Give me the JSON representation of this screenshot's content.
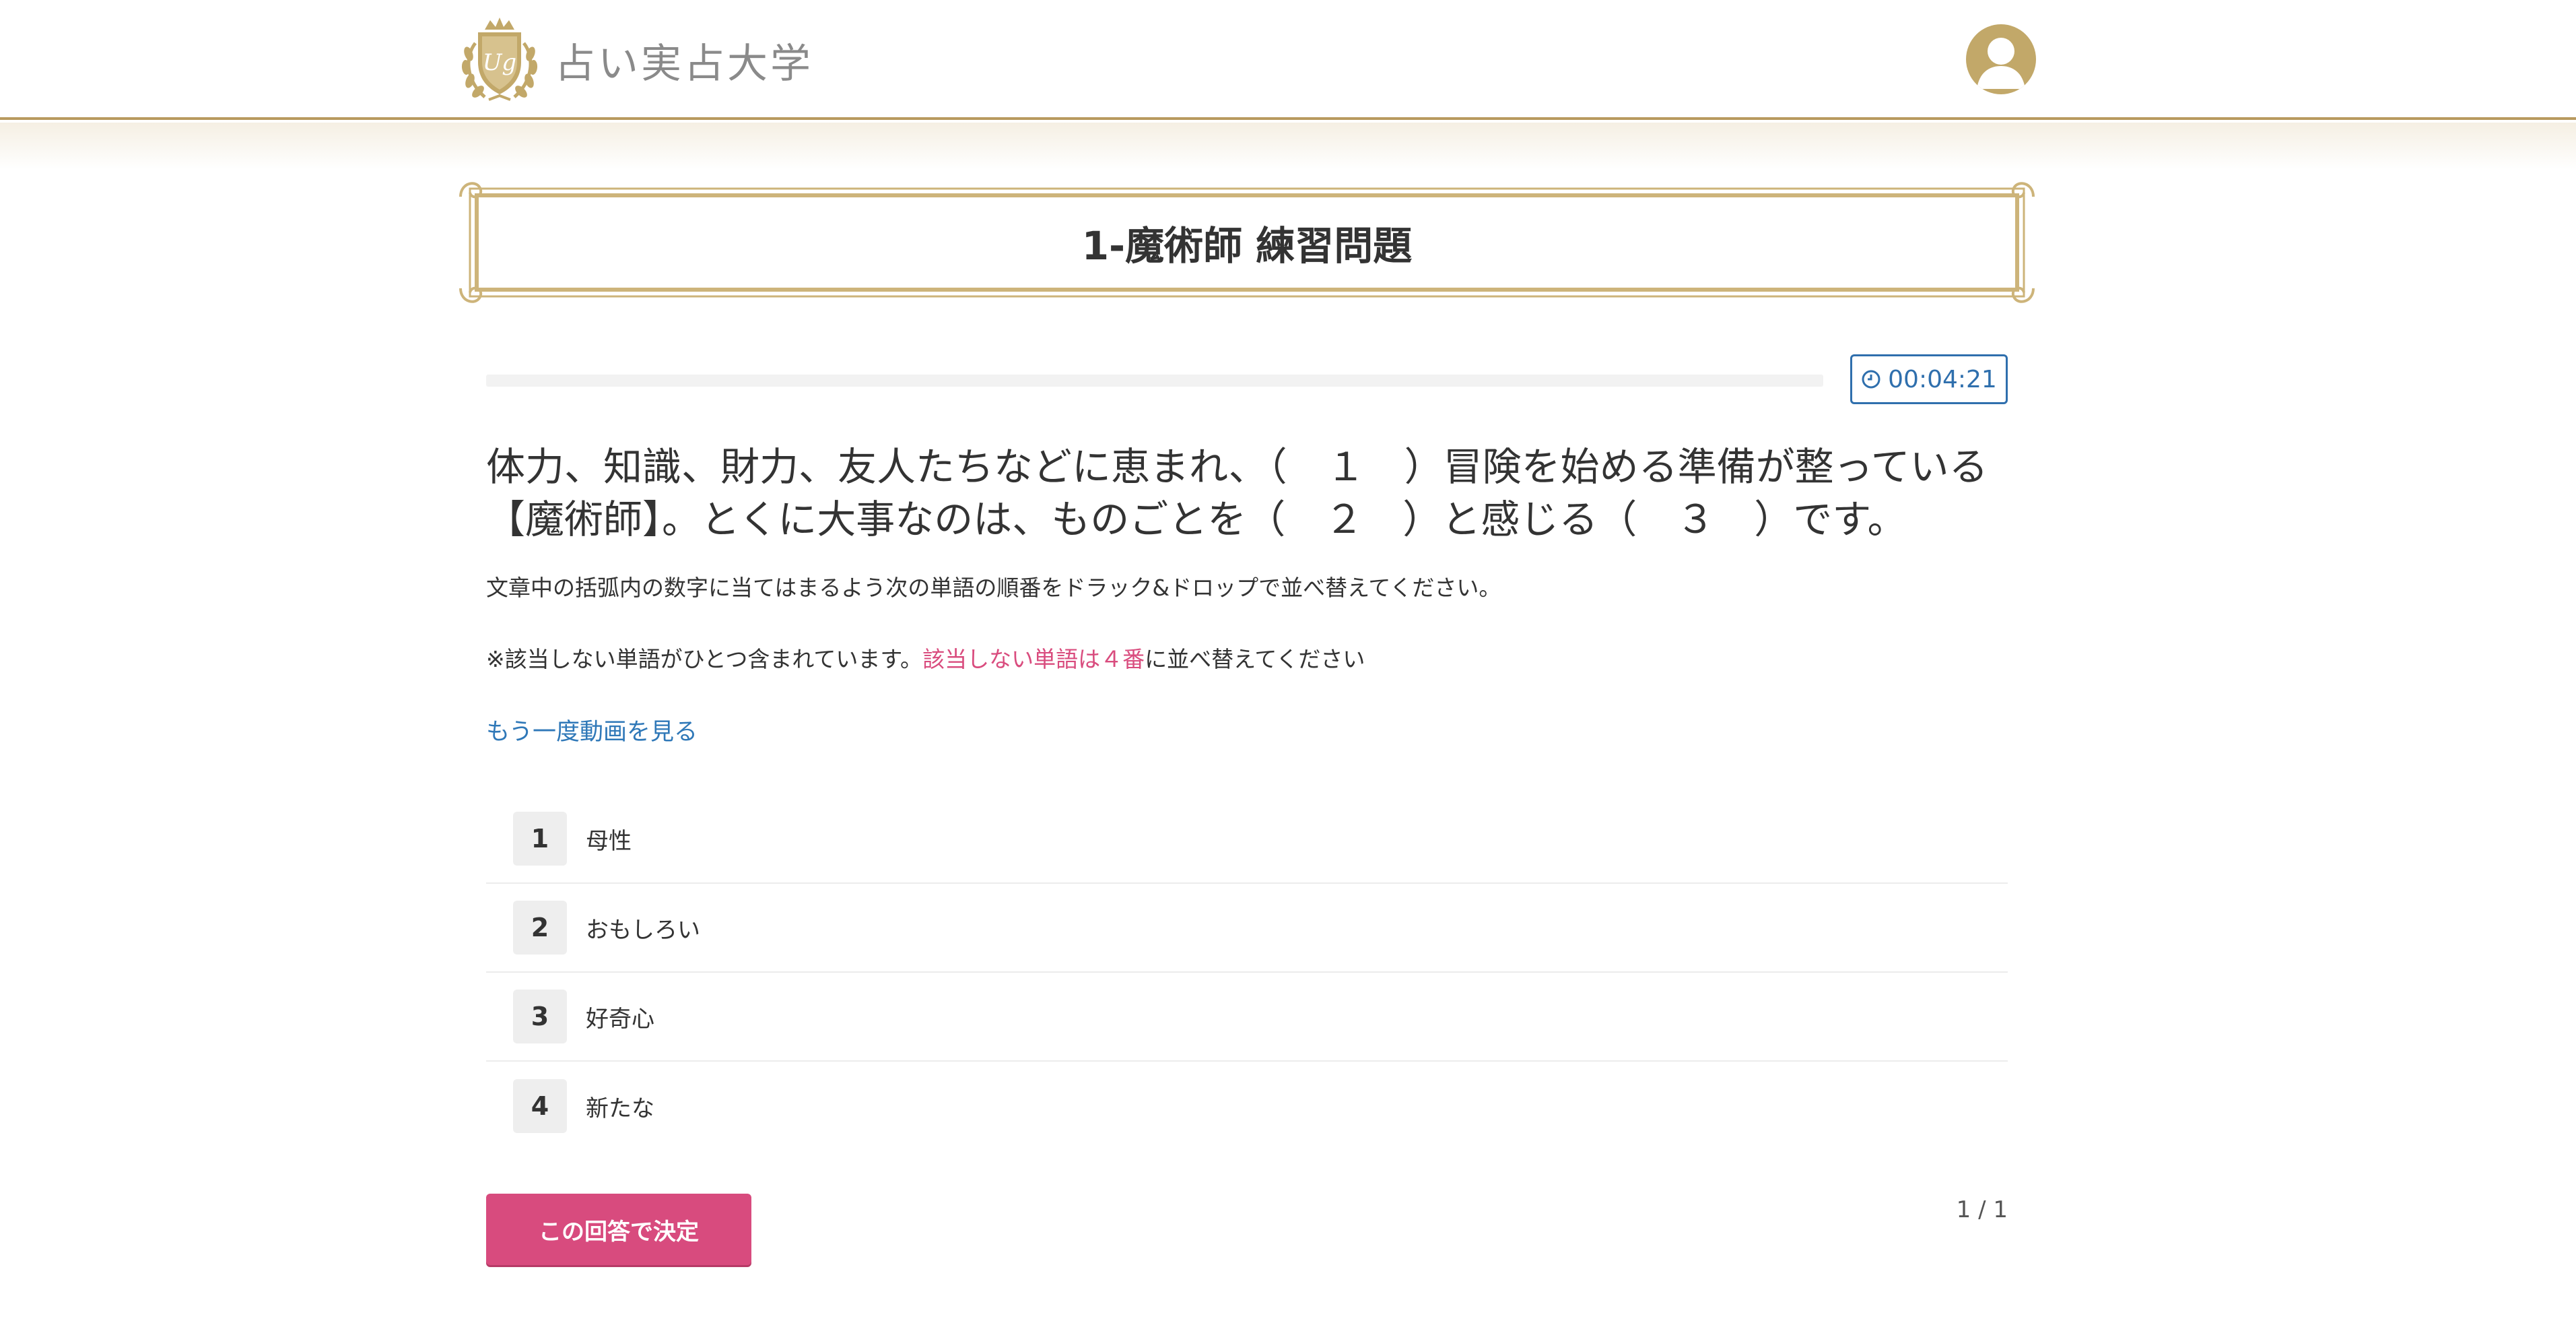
{
  "header": {
    "logo_text": "占い実占大学",
    "logo_emblem_icon": "laurel-crest-emblem-icon",
    "avatar_icon": "user-avatar-icon",
    "accent_color": "#b89a5e"
  },
  "page": {
    "title": "1-魔術師 練習問題"
  },
  "progress": {
    "fraction": 0.0,
    "timer_icon": "clock-icon",
    "timer_value": "00:04:21"
  },
  "question": {
    "text": "体力、知識、財力、友人たちなどに恵まれ、（　１　）冒険を始める準備が整っている【魔術師】。とくに大事なのは、ものごとを（　２　）と感じる（　３　）です。",
    "instruction": "文章中の括弧内の数字に当てはまるよう次の単語の順番をドラック&ドロップで並べ替えてください。",
    "note_prefix": "※該当しない単語がひとつ含まれています。",
    "note_highlight": "該当しない単語は４番",
    "note_suffix": "に並べ替えてください",
    "video_link": "もう一度動画を見る"
  },
  "words": [
    {
      "number": "1",
      "label": "母性"
    },
    {
      "number": "2",
      "label": "おもしろい"
    },
    {
      "number": "3",
      "label": "好奇心"
    },
    {
      "number": "4",
      "label": "新たな"
    }
  ],
  "footer": {
    "submit_label": "この回答で決定",
    "pager": "1 / 1",
    "submit_color": "#d84b7e"
  }
}
